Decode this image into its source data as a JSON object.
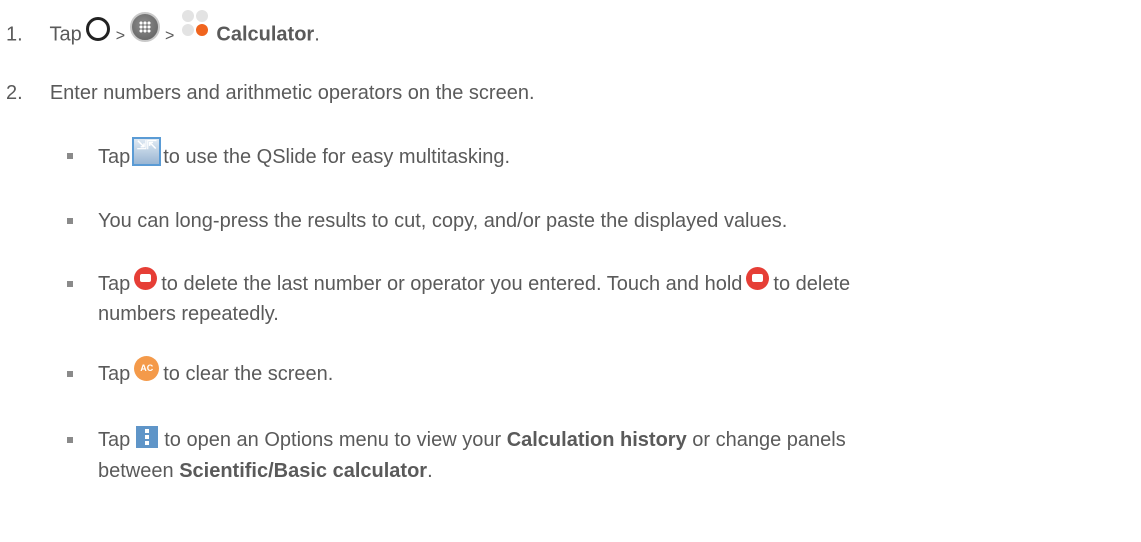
{
  "step1": {
    "number": "1.",
    "tap": "Tap",
    "sep1": ">",
    "sep2": ">",
    "app_name": "Calculator",
    "end": ".",
    "icons": [
      "home-icon",
      "apps-icon",
      "calculator-icon"
    ]
  },
  "step2": {
    "number": "2.",
    "text": "Enter numbers and arithmetic operators on the screen."
  },
  "bullets": {
    "qslide": {
      "tap": "Tap",
      "text": "to use the QSlide for easy multitasking.",
      "icon_label": "⇲⇱"
    },
    "longpress": {
      "text": "You can long-press the results to cut, copy, and/or paste the displayed values."
    },
    "delete": {
      "tap": "Tap",
      "text1": "to delete the last number or operator you entered. Touch and hold",
      "text2": "to delete",
      "text3": "numbers repeatedly."
    },
    "clear": {
      "tap": "Tap",
      "icon_label": "AC",
      "text": "to clear the screen."
    },
    "options": {
      "tap": "Tap",
      "text1": "to open an Options menu to view your",
      "bold1": "Calculation history",
      "text2": "or change panels",
      "text3": "between",
      "bold2": "Scientific/Basic calculator",
      "end": "."
    }
  }
}
